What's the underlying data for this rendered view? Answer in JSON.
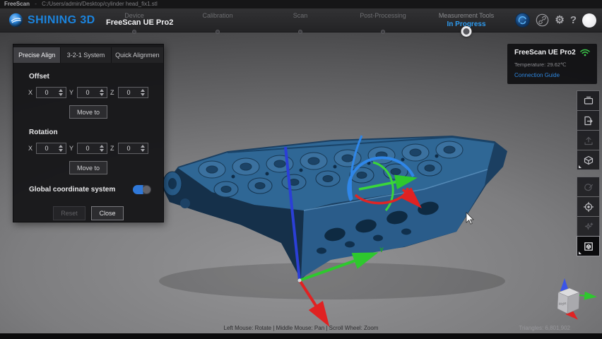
{
  "titlebar": {
    "app_name": "FreeScan",
    "separator": "-",
    "file_path": "C:/Users/admin/Desktop/cylinder head_fix1.stl"
  },
  "menubar": {
    "brand": "SHINING 3D",
    "product": "FreeScan UE Pro2",
    "tabs": [
      {
        "label": "Device"
      },
      {
        "label": "Calibration"
      },
      {
        "label": "Scan"
      },
      {
        "label": "Post-Processing"
      },
      {
        "label": "Measurement Tools"
      }
    ],
    "active_status": "In Progress",
    "icons": {
      "gear_glyph": "⚙",
      "help_glyph": "?"
    }
  },
  "device_panel": {
    "title": "FreeScan UE Pro2",
    "temperature": "Temperature: 29.62℃",
    "connection_link": "Connection Guide",
    "wifi_icon": "wifi-signal",
    "wifi_color": "#3dc84b"
  },
  "align_panel": {
    "tabs": [
      {
        "label": "Precise Align",
        "active": true
      },
      {
        "label": "3-2-1 System",
        "active": false
      },
      {
        "label": "Quick Alignmen",
        "active": false
      }
    ],
    "offset": {
      "section_label": "Offset",
      "x_label": "X",
      "y_label": "Y",
      "z_label": "Z",
      "x_value": "0",
      "y_value": "0",
      "z_value": "0",
      "move_button": "Move to"
    },
    "rotation": {
      "section_label": "Rotation",
      "x_label": "X",
      "y_label": "Y",
      "z_label": "Z",
      "x_value": "0",
      "y_value": "0",
      "z_value": "0",
      "move_button": "Move to"
    },
    "global_coordinate_label": "Global coordinate system",
    "global_coordinate_on": true,
    "reset_button": "Reset",
    "close_button": "Close"
  },
  "toolbar_right": {
    "group1": [
      "scan-view-icon",
      "export-file-icon",
      "upload-icon",
      "model-cube-icon"
    ],
    "group2": [
      "mesh-edit-icon",
      "locate-target-icon",
      "magic-select-icon",
      "bounding-box-icon"
    ]
  },
  "viewport": {
    "hint": "Left Mouse: Rotate | Middle Mouse: Pan | Scroll Wheel: Zoom",
    "triangles": "Triangles: 6,801,902",
    "axis_label_y": "Y",
    "nav_cube_face_label": "Right"
  },
  "colors": {
    "brand_blue": "#1b84de",
    "progress_blue": "#2e9bf0",
    "link_blue": "#2e86de",
    "wifi_green": "#3dc84b",
    "axis_green": "#2ec82e",
    "axis_red": "#e02222",
    "axis_blue": "#2b3fd6",
    "model_blue": "#2a5c8a"
  }
}
